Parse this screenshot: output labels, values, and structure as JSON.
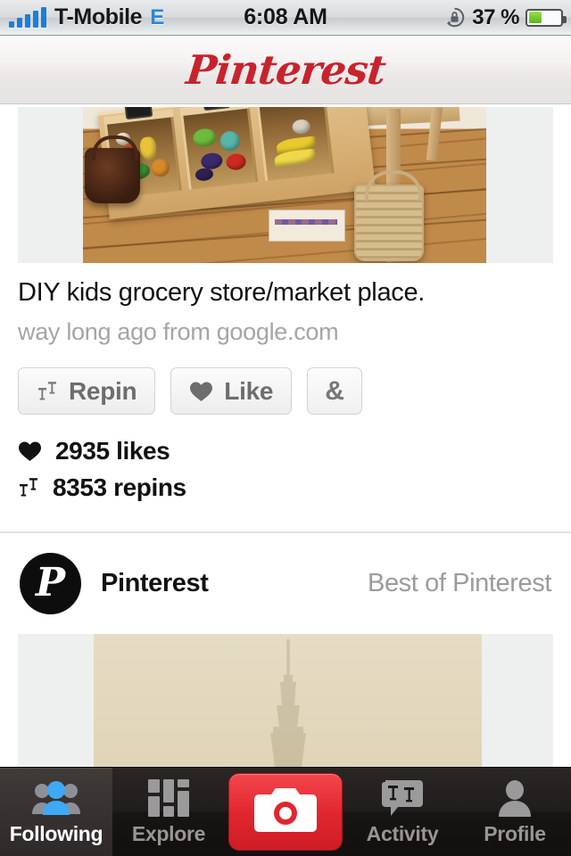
{
  "status_bar": {
    "carrier": "T-Mobile",
    "network_mode": "E",
    "time": "6:08 AM",
    "battery_percent": "37 %",
    "battery_level": 37,
    "signal_bars": 5,
    "rotation_lock": true
  },
  "header": {
    "logo_text": "Pinterest",
    "logo_color": "#c8232c"
  },
  "pin": {
    "title": "DIY kids grocery store/market place.",
    "source": "way long ago from google.com",
    "actions": {
      "repin_label": "Repin",
      "like_label": "Like",
      "share_label": "&"
    },
    "stats": {
      "likes_text": "2935 likes",
      "repins_text": "8353 repins",
      "likes_count": 2935,
      "repins_count": 8353
    }
  },
  "board": {
    "avatar_letter": "P",
    "username": "Pinterest",
    "board_name": "Best of Pinterest"
  },
  "tab_bar": {
    "tabs": [
      {
        "label": "Following",
        "icon": "people-icon",
        "active": true
      },
      {
        "label": "Explore",
        "icon": "grid-icon",
        "active": false
      },
      {
        "label": "Activity",
        "icon": "speech-bubble-pins-icon",
        "active": false
      },
      {
        "label": "Profile",
        "icon": "person-icon",
        "active": false
      }
    ],
    "camera_label": "camera-icon",
    "active_color": "#ffffff",
    "inactive_color": "#9a9594",
    "camera_color": "#e0262e"
  }
}
